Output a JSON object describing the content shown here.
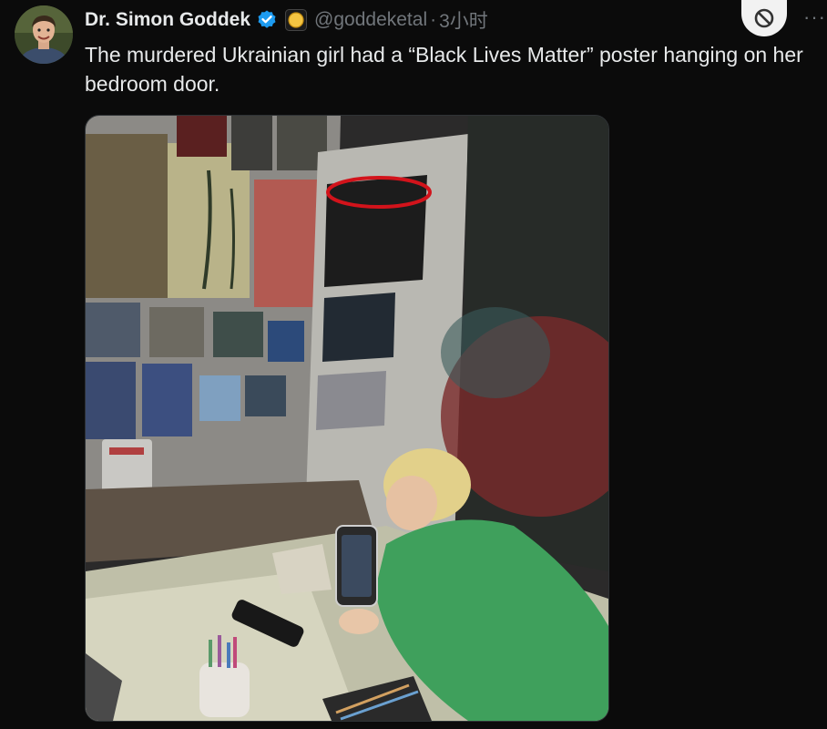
{
  "author": {
    "name": "Dr. Simon Goddek",
    "handle": "@goddeketal",
    "separator": "·",
    "time": "3小时"
  },
  "tweet": {
    "text": "The murdered Ukrainian girl had a “Black Lives Matter” poster hanging on her bedroom door."
  },
  "actions": {
    "more": "···"
  },
  "icons": {
    "verified": "verified-check-icon",
    "badge": "gold-circle-badge-icon",
    "block": "block-icon"
  },
  "colors": {
    "background": "#0b0b0b",
    "text": "#e7e9ea",
    "muted": "#71767b",
    "verified": "#1d9bf0",
    "badge": "#f4c542",
    "annotation": "#d2131b"
  }
}
